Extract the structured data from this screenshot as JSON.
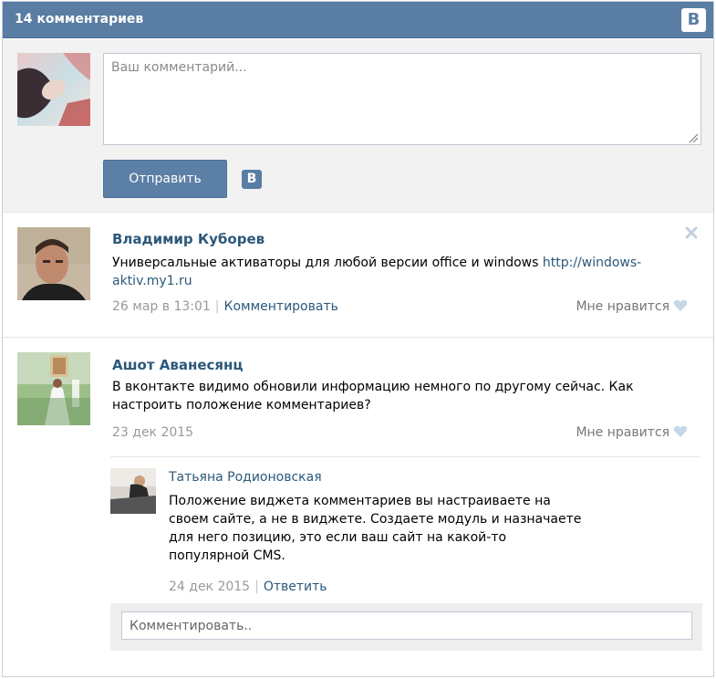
{
  "header": {
    "title": "14 комментариев",
    "logo": "В"
  },
  "compose": {
    "placeholder": "Ваш комментарий...",
    "send_label": "Отправить",
    "logo": "В"
  },
  "comments": [
    {
      "author": "Владимир Куборев",
      "text": "Универсальные активаторы для любой версии office и windows ",
      "link": "http://windows-aktiv.my1.ru",
      "date": "26 мар в 13:01",
      "action": "Комментировать",
      "like": "Мне нравится",
      "icons": [
        "avatar",
        "close-icon",
        "heart-icon"
      ]
    },
    {
      "author": "Ашот Аванесянц",
      "text": "В вконтакте видимо обновили информацию немного по другому сейчас. Как настроить положение комментариев?",
      "date": "23 дек 2015",
      "like": "Мне нравится",
      "replies": [
        {
          "author": "Татьяна Родионовская",
          "text": "Положение виджета комментариев вы настраиваете на своем сайте, а не в виджете. Создаете модуль и назначаете для него позицию, это если ваш сайт на какой-то популярной CMS.",
          "date": "24 дек 2015",
          "action": "Ответить"
        }
      ],
      "reply_placeholder": "Комментировать.."
    }
  ],
  "colors": {
    "header": "#597da3",
    "link": "#2b587a",
    "muted": "#999999",
    "button": "#5c7fa6"
  }
}
